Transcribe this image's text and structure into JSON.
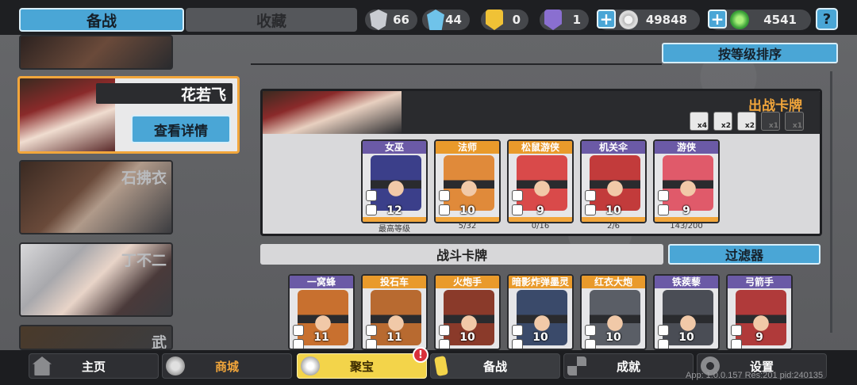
{
  "top_tabs": {
    "active": "备战",
    "other": "收藏"
  },
  "resources": [
    {
      "icon": "silver-shield-icon",
      "value": "66",
      "color": "#c9ccd2"
    },
    {
      "icon": "blue-crystal-icon",
      "value": "44",
      "color": "#6fc3ea"
    },
    {
      "icon": "gold-badge-icon",
      "value": "0",
      "color": "#f0c236"
    },
    {
      "icon": "purple-badge-icon",
      "value": "1",
      "color": "#8a6fd0"
    }
  ],
  "currency": {
    "silver": "49848",
    "green": "4541"
  },
  "help_label": "?",
  "sort_button": "按等级排序",
  "characters": [
    {
      "name": ""
    },
    {
      "name": "花若飞",
      "selected": true,
      "detail_label": "查看详情"
    },
    {
      "name": "石拂衣"
    },
    {
      "name": "丁不二"
    },
    {
      "name": "武"
    }
  ],
  "deploy": {
    "title": "出战卡牌",
    "multipliers": [
      "x4",
      "x2",
      "x2",
      "x1",
      "x1"
    ],
    "cards": [
      {
        "name": "女巫",
        "level": "12",
        "sub": "最高等级",
        "frame": "purple",
        "art": "#3b3f8a"
      },
      {
        "name": "法师",
        "level": "10",
        "sub": "5/32",
        "frame": "orange",
        "art": "#e08a3a"
      },
      {
        "name": "松鼠游侠",
        "level": "9",
        "sub": "0/16",
        "frame": "orange",
        "art": "#d94a4a"
      },
      {
        "name": "机关伞",
        "level": "10",
        "sub": "2/6",
        "frame": "purple",
        "art": "#c23b3b"
      },
      {
        "name": "游侠",
        "level": "9",
        "sub": "143/200",
        "frame": "purple",
        "art": "#e05a6a"
      }
    ]
  },
  "battle": {
    "title": "战斗卡牌",
    "filter_label": "过滤器",
    "cards": [
      {
        "name": "一窝蜂",
        "level": "11",
        "frame": "purple",
        "art": "#c8702f"
      },
      {
        "name": "投石车",
        "level": "11",
        "frame": "orange",
        "art": "#b86a30"
      },
      {
        "name": "火炮手",
        "level": "10",
        "frame": "orange",
        "art": "#8a3a2a"
      },
      {
        "name": "暗影炸弹墨灵",
        "level": "10",
        "frame": "orange",
        "art": "#3a4a6a"
      },
      {
        "name": "红衣大炮",
        "level": "10",
        "frame": "orange",
        "art": "#5a5e66"
      },
      {
        "name": "铁蒺藜",
        "level": "10",
        "frame": "purple",
        "art": "#4a4d55"
      },
      {
        "name": "弓箭手",
        "level": "9",
        "frame": "purple",
        "art": "#b03a3a"
      }
    ]
  },
  "nav": [
    {
      "label": "主页",
      "icon": "home-icon"
    },
    {
      "label": "商城",
      "icon": "coins-icon"
    },
    {
      "label": "聚宝",
      "icon": "treasure-bowl-icon",
      "badge": "!"
    },
    {
      "label": "备战",
      "icon": "cards-icon"
    },
    {
      "label": "成就",
      "icon": "achievement-icon"
    },
    {
      "label": "设置",
      "icon": "gear-icon"
    }
  ],
  "version": "App: 1.0.0.157 Res:201 pid:240135"
}
